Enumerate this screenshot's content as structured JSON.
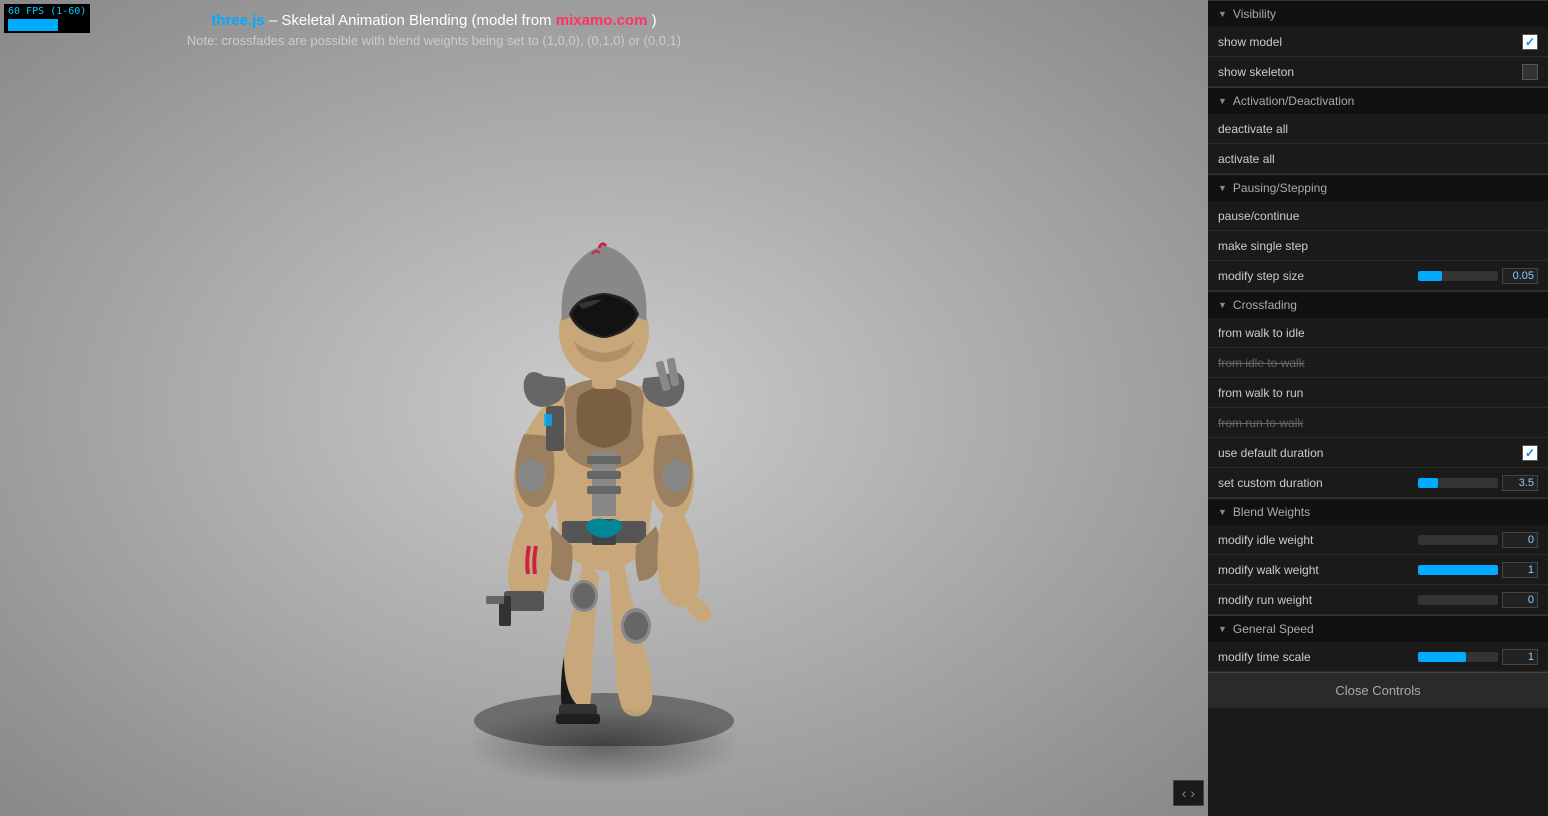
{
  "fps": {
    "label": "60 FPS (1-60)"
  },
  "title": {
    "line1_pre": "three.js",
    "line1_sep": " – Skeletal Animation Blending (model from ",
    "line1_link": "mixamo.com",
    "line1_post": ")",
    "line2": "Note: crossfades are possible with blend weights being set to (1,0,0), (0,1,0) or (0,0,1)"
  },
  "panel": {
    "sections": {
      "visibility": {
        "label": "Visibility",
        "show_model_label": "show model",
        "show_model_checked": true,
        "show_skeleton_label": "show skeleton",
        "show_skeleton_checked": false
      },
      "activation": {
        "label": "Activation/Deactivation",
        "deactivate_all_label": "deactivate all",
        "activate_all_label": "activate all"
      },
      "pausing": {
        "label": "Pausing/Stepping",
        "pause_continue_label": "pause/continue",
        "make_single_step_label": "make single step",
        "modify_step_size_label": "modify step size",
        "modify_step_size_value": "0.05",
        "modify_step_size_pct": 30
      },
      "crossfading": {
        "label": "Crossfading",
        "from_walk_to_idle_label": "from walk to idle",
        "from_idle_to_walk_label": "from idle to walk",
        "from_walk_to_run_label": "from walk to run",
        "from_run_to_walk_label": "from run to walk",
        "use_default_duration_label": "use default duration",
        "use_default_duration_checked": true,
        "set_custom_duration_label": "set custom duration",
        "set_custom_duration_value": "3.5",
        "set_custom_duration_pct": 25
      },
      "blend_weights": {
        "label": "Blend Weights",
        "modify_idle_weight_label": "modify idle weight",
        "modify_idle_weight_value": "0",
        "modify_idle_weight_pct": 0,
        "modify_walk_weight_label": "modify walk weight",
        "modify_walk_weight_value": "1",
        "modify_walk_weight_pct": 100,
        "modify_run_weight_label": "modify run weight",
        "modify_run_weight_value": "0",
        "modify_run_weight_pct": 0
      },
      "general_speed": {
        "label": "General Speed",
        "modify_time_scale_label": "modify time scale",
        "modify_time_scale_value": "1",
        "modify_time_scale_pct": 60
      }
    },
    "close_controls_label": "Close Controls"
  },
  "expand_icon": "‹ ›"
}
